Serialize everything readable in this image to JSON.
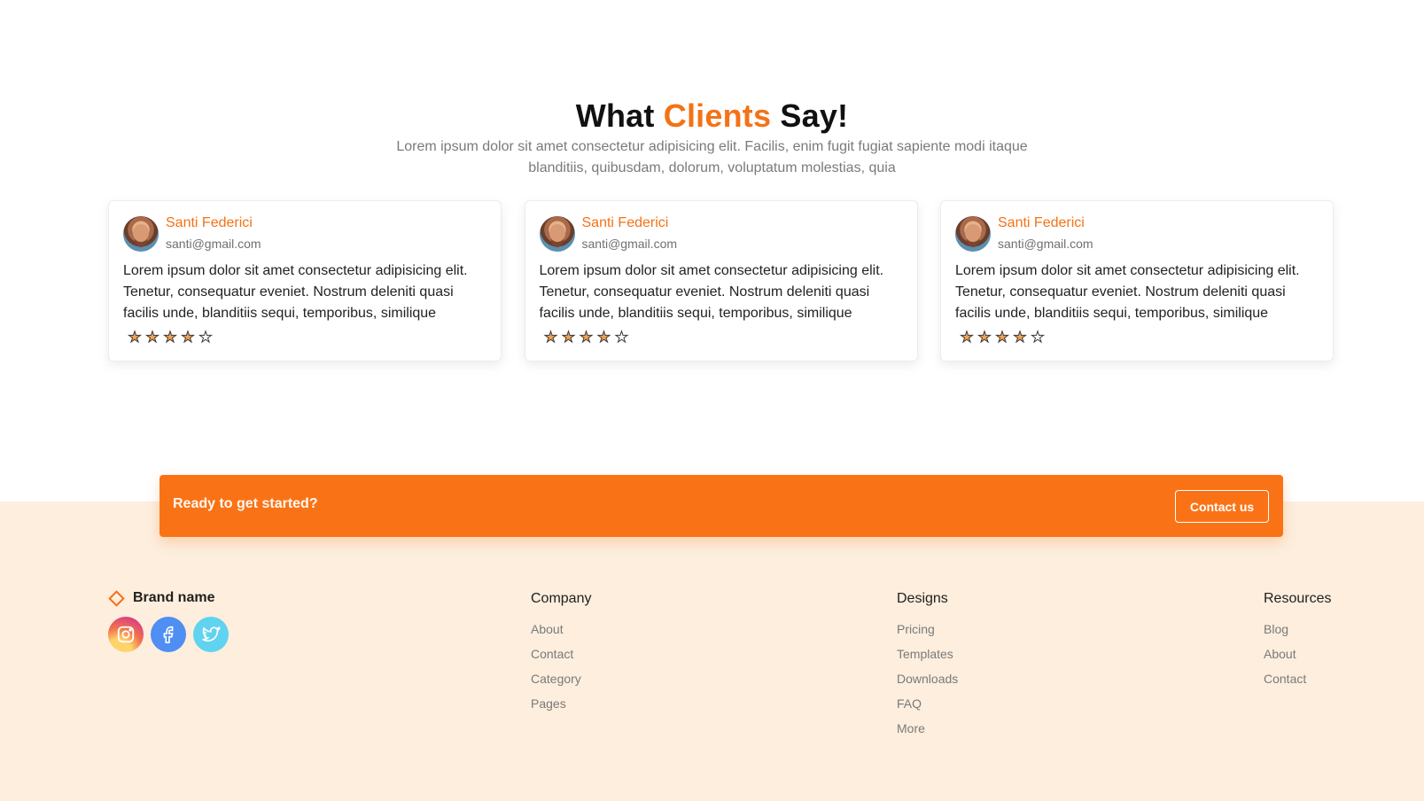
{
  "testimonials": {
    "title_prefix": "What",
    "title_accent": "Clients",
    "title_suffix": "Say!",
    "subtitle": "Lorem ipsum dolor sit amet consectetur adipisicing elit. Facilis, enim fugit fugiat sapiente modi itaque blanditiis, quibusdam, dolorum, voluptatum molestias, quia",
    "cards": [
      {
        "name": "Santi Federici",
        "email": "santi@gmail.com",
        "quote": "Lorem ipsum dolor sit amet consectetur adipisicing elit. Tenetur, consequatur eveniet. Nostrum deleniti quasi facilis unde, blanditiis sequi, temporibus, similique",
        "rating": 4,
        "rating_max": 5
      },
      {
        "name": "Santi Federici",
        "email": "santi@gmail.com",
        "quote": "Lorem ipsum dolor sit amet consectetur adipisicing elit. Tenetur, consequatur eveniet. Nostrum deleniti quasi facilis unde, blanditiis sequi, temporibus, similique",
        "rating": 4,
        "rating_max": 5
      },
      {
        "name": "Santi Federici",
        "email": "santi@gmail.com",
        "quote": "Lorem ipsum dolor sit amet consectetur adipisicing elit. Tenetur, consequatur eveniet. Nostrum deleniti quasi facilis unde, blanditiis sequi, temporibus, similique",
        "rating": 4,
        "rating_max": 5
      }
    ]
  },
  "cta": {
    "text": "Ready to get started?",
    "button_label": "Contact us"
  },
  "footer": {
    "brand_name": "Brand name",
    "brand_icon": "diamond-icon",
    "socials": [
      "instagram-icon",
      "facebook-icon",
      "twitter-icon"
    ],
    "columns": [
      {
        "title": "Company",
        "links": [
          "About",
          "Contact",
          "Category",
          "Pages"
        ]
      },
      {
        "title": "Designs",
        "links": [
          "Pricing",
          "Templates",
          "Downloads",
          "FAQ",
          "More"
        ]
      },
      {
        "title": "Resources",
        "links": [
          "Blog",
          "About",
          "Contact"
        ]
      }
    ]
  },
  "colors": {
    "accent": "#f47216",
    "cta_background": "#f97316",
    "footer_background": "#fdeedd",
    "star_fill": "#f6a04f"
  }
}
